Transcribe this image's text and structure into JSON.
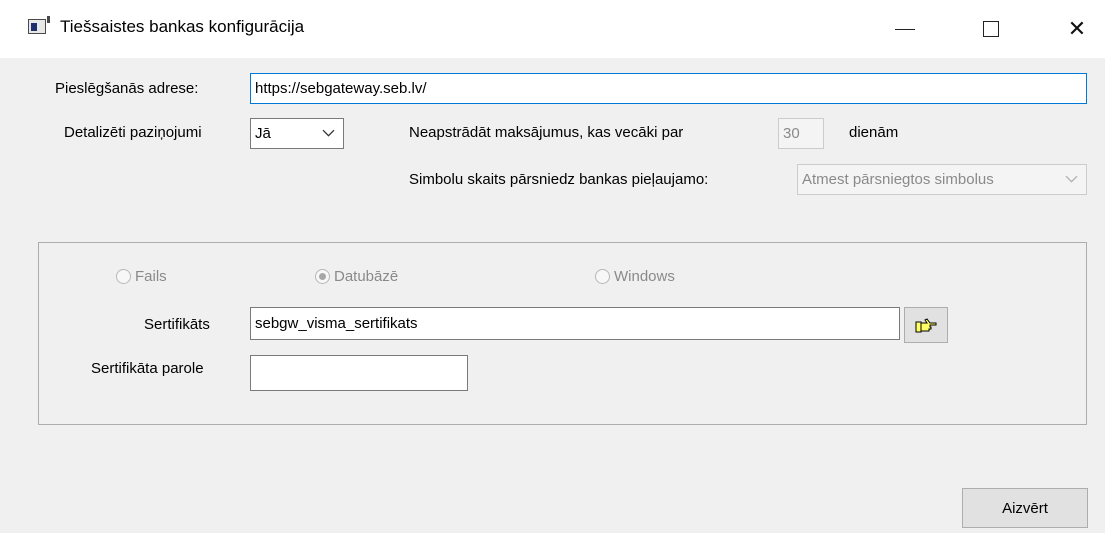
{
  "window": {
    "title": "Tiešsaistes bankas konfigurācija",
    "controls": {
      "minimize": "—",
      "close": "✕"
    }
  },
  "form": {
    "address_label": "Pieslēgšanās adrese:",
    "address_value": "https://sebgateway.seb.lv/",
    "detailed_label": "Detalizēti paziņojumi",
    "detailed_value": "Jā",
    "skip_label": "Neapstrādāt maksājumus, kas vecāki par",
    "skip_days": "30",
    "days_unit": "dienām",
    "symbols_label": "Simbolu skaits pārsniedz bankas pieļaujamo:",
    "symbols_value": "Atmest pārsniegtos simbolus"
  },
  "certificate": {
    "radio_file": "Fails",
    "radio_db": "Datubāzē",
    "radio_windows": "Windows",
    "selected": "Datubāzē",
    "cert_label": "Sertifikāts",
    "cert_value": "sebgw_visma_sertifikats",
    "password_label": "Sertifikāta parole",
    "password_value": ""
  },
  "footer": {
    "close_label": "Aizvērt"
  },
  "icons": {
    "app": "app-window-icon",
    "browse": "pointing-hand-icon"
  }
}
